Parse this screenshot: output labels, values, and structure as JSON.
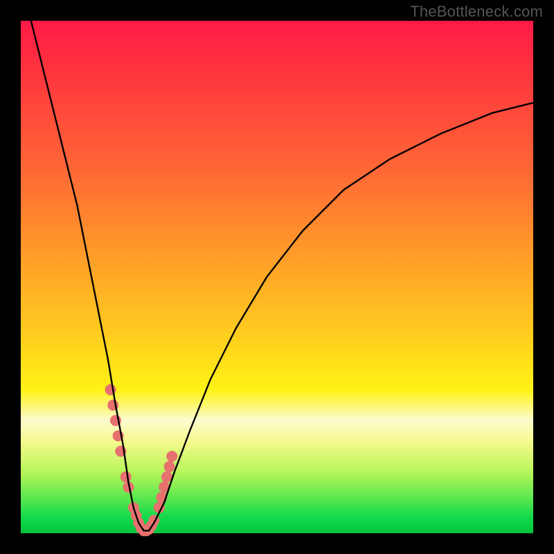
{
  "watermark": "TheBottleneck.com",
  "chart_data": {
    "type": "line",
    "title": "",
    "xlabel": "",
    "ylabel": "",
    "xlim": [
      0,
      100
    ],
    "ylim": [
      0,
      100
    ],
    "series": [
      {
        "name": "bottleneck-curve",
        "x": [
          2,
          5,
          8,
          11,
          13,
          15,
          17,
          18.5,
          20,
          21,
          22,
          23,
          24,
          25,
          26,
          28,
          30,
          33,
          37,
          42,
          48,
          55,
          63,
          72,
          82,
          92,
          100
        ],
        "values": [
          100,
          88,
          76,
          64,
          54,
          44,
          34,
          25,
          17,
          10,
          5,
          2,
          0.5,
          0.5,
          2,
          6,
          12,
          20,
          30,
          40,
          50,
          59,
          67,
          73,
          78,
          82,
          84
        ]
      }
    ],
    "markers": {
      "name": "highlight-dots",
      "x": [
        17.5,
        18,
        18.5,
        19,
        19.5,
        20.5,
        21,
        22,
        22.5,
        23,
        23.5,
        24,
        24.5,
        25,
        25.5,
        26,
        27,
        27.5,
        28,
        28.5,
        29,
        29.5
      ],
      "values": [
        28,
        25,
        22,
        19,
        16,
        11,
        9,
        5,
        3.5,
        2,
        1,
        0.5,
        0.5,
        0.8,
        1.5,
        2.5,
        5,
        7,
        9,
        11,
        13,
        15
      ],
      "color": "#e7716f",
      "size": 16
    }
  }
}
